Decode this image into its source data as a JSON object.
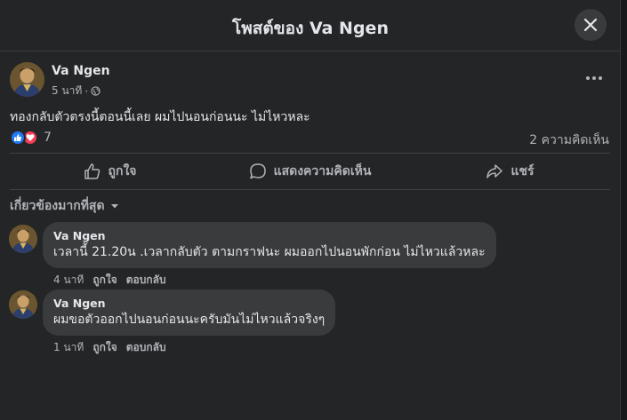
{
  "header": {
    "title": "โพสต์ของ Va Ngen",
    "close_icon": "close-icon"
  },
  "post": {
    "author": "Va Ngen",
    "time": "5 นาที",
    "separator": "·",
    "privacy_icon": "globe-icon",
    "text": "ทองกลับตัวตรงนี้ตอนนี้เลย ผมไปนอนก่อนนะ ไม่ไหวหละ",
    "reactions": {
      "icons": [
        "like-icon",
        "love-icon"
      ],
      "count": "7"
    },
    "comments_count": "2 ความคิดเห็น"
  },
  "actions": {
    "like": "ถูกใจ",
    "comment": "แสดงความคิดเห็น",
    "share": "แชร์"
  },
  "sort": {
    "label": "เกี่ยวข้องมากที่สุด"
  },
  "comments": [
    {
      "author": "Va Ngen",
      "text": "เวลานี้ 21.20น .เวลากลับตัว ตามกราฟนะ ผมออกไปนอนพักก่อน ไม่ไหวแล้วหละ",
      "time": "4 นาที",
      "like": "ถูกใจ",
      "reply": "ตอบกลับ"
    },
    {
      "author": "Va Ngen",
      "text": "ผมขอตัวออกไปนอนก่อนนะครับมันไม่ไหวแล้วจริงๆ",
      "time": "1 นาที",
      "like": "ถูกใจ",
      "reply": "ตอบกลับ"
    }
  ],
  "colors": {
    "background": "#242526",
    "bubble": "#3a3b3c",
    "text_primary": "#e4e6eb",
    "text_secondary": "#b0b3b8",
    "like_blue": "#2078f4",
    "love_red": "#f33e58"
  }
}
